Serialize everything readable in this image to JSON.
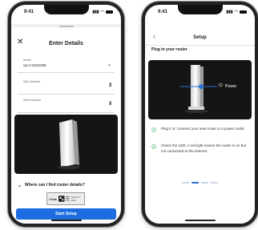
{
  "left_phone": {
    "status": {
      "time": "9:41"
    },
    "header": {
      "title": "Enter Details",
      "close_icon": "close-icon"
    },
    "fields": {
      "model": {
        "label": "Model",
        "value": "u6.3 G542298"
      },
      "mac": {
        "label": "MAC Address",
        "value": ""
      },
      "serial": {
        "label": "Serial Number",
        "value": ""
      }
    },
    "find_details": "Where can I find router details?",
    "sticker": {
      "brand": "Code",
      "text": "Serial # / MAC"
    },
    "button": "Start Setup"
  },
  "right_phone": {
    "status": {
      "time": "9:41"
    },
    "header": {
      "title": "Setup"
    },
    "section_title": "Plug in your router",
    "power_label": "Power",
    "steps": [
      "Plug it in: Connect your new router to a power outlet.",
      "Check the LED: A red light means the router is on but not connected to the internet."
    ],
    "pager": {
      "total": 4,
      "active": 2
    }
  },
  "colors": {
    "accent": "#1e6de0",
    "led": "#2a6fd6",
    "success": "#8fd0a8"
  }
}
